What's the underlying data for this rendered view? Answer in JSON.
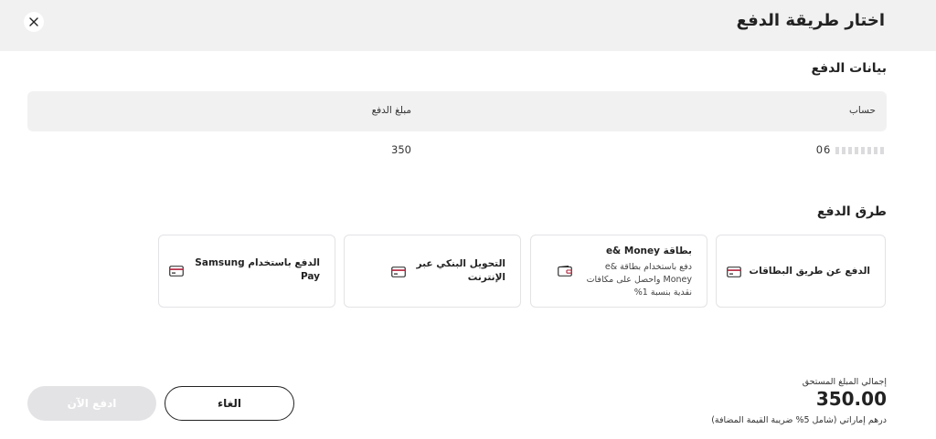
{
  "modal": {
    "title": "اختار طريقة الدفع",
    "close_icon": "close-icon"
  },
  "payment_details": {
    "heading": "بيانات الدفع",
    "columns": [
      "حساب",
      "مبلغ الدفع"
    ],
    "row": {
      "account": "06",
      "amount": "350"
    }
  },
  "payment_methods": {
    "heading": "طرق الدفع",
    "items": [
      {
        "title": "الدفع عن طريق البطاقات",
        "description": "",
        "icon": "credit-card-icon"
      },
      {
        "title": "بطاقة e& Money",
        "description": "دفع باستخدام بطاقة e& Money واحصل على مكافات نقدية بنسبة 1%",
        "icon": "wallet-icon"
      },
      {
        "title": "التحويل البنكي عبر الإنترنت",
        "description": "",
        "icon": "credit-card-icon"
      },
      {
        "title": "الدفع باستخدام Samsung Pay",
        "description": "",
        "icon": "credit-card-icon"
      }
    ]
  },
  "footer": {
    "total_label": "إجمالي المبلغ المستحق",
    "total_amount": "350.00",
    "vat_note": "درهم إماراتي (شامل 5% ضريبة القيمة المضافة)",
    "cancel_label": "الغاء",
    "pay_label": "ادفع الآن",
    "pay_disabled": true
  },
  "colors": {
    "header_bg": "#f1f1f2",
    "accent": "#b0203a",
    "disabled_button": "#e3e3e5"
  }
}
